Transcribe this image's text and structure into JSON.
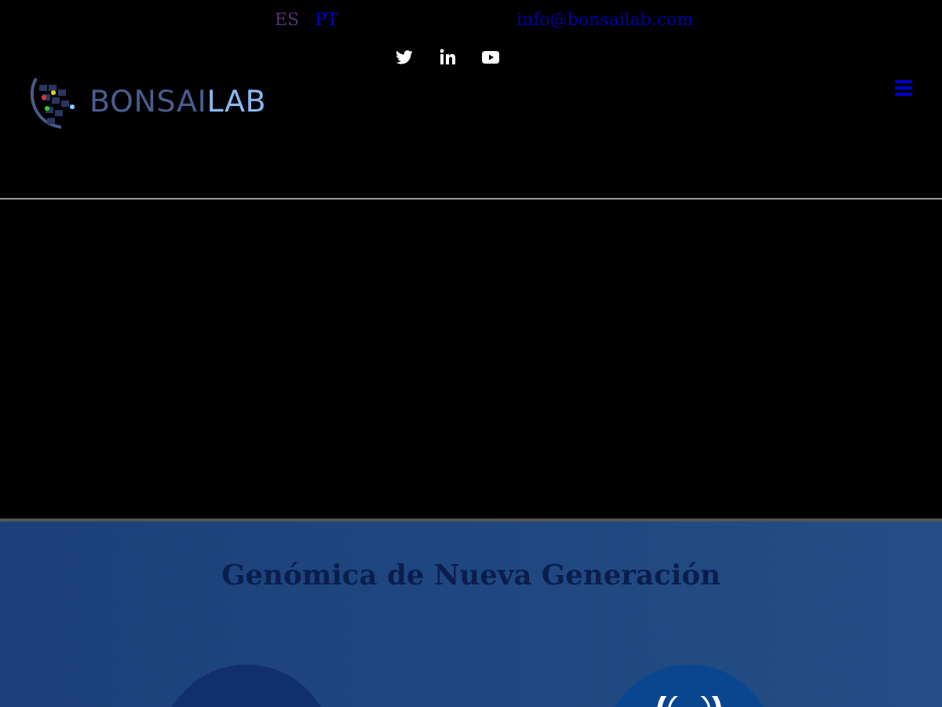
{
  "top_bar": {
    "languages": [
      {
        "label": "ES",
        "selected": true
      },
      {
        "label": "PT",
        "selected": false
      }
    ],
    "email": "info@bonsailab.com"
  },
  "social": [
    {
      "kind": "twitter"
    },
    {
      "kind": "linkedin"
    },
    {
      "kind": "youtube"
    }
  ],
  "logo": {
    "part_1": "BONSAI",
    "part_2": "LAB"
  },
  "section": {
    "title": "Genómica de Nueva Generación",
    "features": [
      {
        "kind": "plain"
      },
      {
        "kind": "ring"
      }
    ]
  }
}
